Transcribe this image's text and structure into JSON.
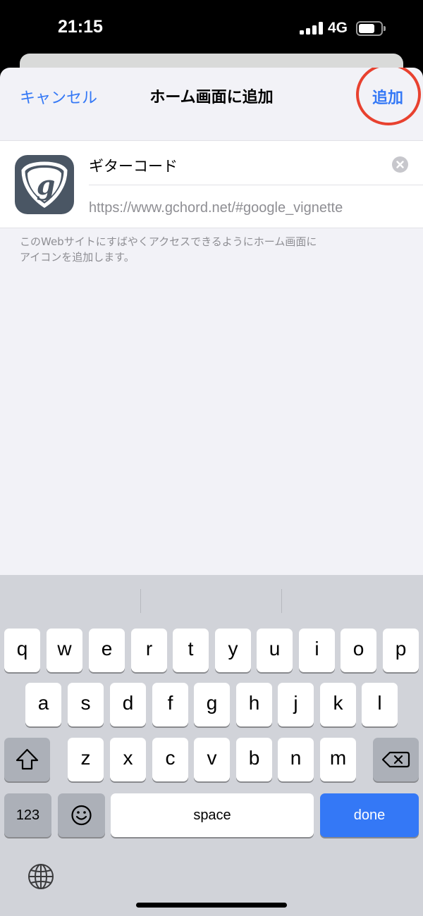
{
  "status_bar": {
    "time": "21:15",
    "network": "4G"
  },
  "nav": {
    "cancel_label": "キャンセル",
    "title": "ホーム画面に追加",
    "add_label": "追加"
  },
  "form": {
    "app_icon": "guitar-pick-g-icon",
    "name_value": "ギターコード",
    "url_value": "https://www.gchord.net/#google_vignette"
  },
  "description": {
    "line1": "このWebサイトにすばやくアクセスできるようにホーム画面に",
    "line2": "アイコンを追加します。"
  },
  "keyboard": {
    "row1": [
      "q",
      "w",
      "e",
      "r",
      "t",
      "y",
      "u",
      "i",
      "o",
      "p"
    ],
    "row2": [
      "a",
      "s",
      "d",
      "f",
      "g",
      "h",
      "j",
      "k",
      "l"
    ],
    "row3": [
      "z",
      "x",
      "c",
      "v",
      "b",
      "n",
      "m"
    ],
    "numbers_label": "123",
    "space_label": "space",
    "done_label": "done",
    "icons": {
      "shift": "shift-icon",
      "delete": "delete-icon",
      "emoji": "emoji-icon",
      "globe": "globe-icon"
    }
  },
  "colors": {
    "accent": "#3478f6",
    "annotation": "#e8412f",
    "app_icon_bg": "#4a5664"
  }
}
